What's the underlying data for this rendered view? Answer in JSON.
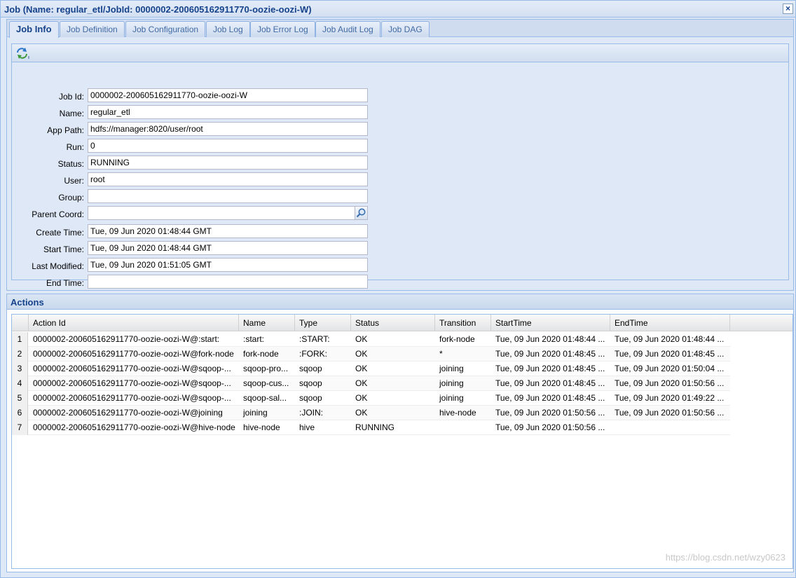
{
  "window": {
    "title": "Job (Name: regular_etl/JobId: 0000002-200605162911770-oozie-oozi-W)",
    "close_label": "×"
  },
  "tabs": [
    {
      "label": "Job Info",
      "active": true
    },
    {
      "label": "Job Definition",
      "active": false
    },
    {
      "label": "Job Configuration",
      "active": false
    },
    {
      "label": "Job Log",
      "active": false
    },
    {
      "label": "Job Error Log",
      "active": false
    },
    {
      "label": "Job Audit Log",
      "active": false
    },
    {
      "label": "Job DAG",
      "active": false
    }
  ],
  "form": {
    "refresh_icon": "refresh-icon",
    "fields": [
      {
        "label": "Job Id:",
        "value": "0000002-200605162911770-oozie-oozi-W"
      },
      {
        "label": "Name:",
        "value": "regular_etl"
      },
      {
        "label": "App Path:",
        "value": "hdfs://manager:8020/user/root"
      },
      {
        "label": "Run:",
        "value": "0"
      },
      {
        "label": "Status:",
        "value": "RUNNING"
      },
      {
        "label": "User:",
        "value": "root"
      },
      {
        "label": "Group:",
        "value": ""
      },
      {
        "label": "Parent Coord:",
        "value": "",
        "trigger_icon": "magnifier-icon"
      },
      {
        "label": "Create Time:",
        "value": "Tue, 09 Jun 2020 01:48:44 GMT"
      },
      {
        "label": "Start Time:",
        "value": "Tue, 09 Jun 2020 01:48:44 GMT"
      },
      {
        "label": "Last Modified:",
        "value": "Tue, 09 Jun 2020 01:51:05 GMT"
      },
      {
        "label": "End Time:",
        "value": ""
      }
    ]
  },
  "actions": {
    "title": "Actions",
    "columns": [
      "Action Id",
      "Name",
      "Type",
      "Status",
      "Transition",
      "StartTime",
      "EndTime"
    ],
    "rows": [
      {
        "num": "1",
        "cells": [
          "0000002-200605162911770-oozie-oozi-W@:start:",
          ":start:",
          ":START:",
          "OK",
          "fork-node",
          "Tue, 09 Jun 2020 01:48:44 ...",
          "Tue, 09 Jun 2020 01:48:44 ..."
        ]
      },
      {
        "num": "2",
        "cells": [
          "0000002-200605162911770-oozie-oozi-W@fork-node",
          "fork-node",
          ":FORK:",
          "OK",
          "*",
          "Tue, 09 Jun 2020 01:48:45 ...",
          "Tue, 09 Jun 2020 01:48:45 ..."
        ]
      },
      {
        "num": "3",
        "cells": [
          "0000002-200605162911770-oozie-oozi-W@sqoop-...",
          "sqoop-pro...",
          "sqoop",
          "OK",
          "joining",
          "Tue, 09 Jun 2020 01:48:45 ...",
          "Tue, 09 Jun 2020 01:50:04 ..."
        ]
      },
      {
        "num": "4",
        "cells": [
          "0000002-200605162911770-oozie-oozi-W@sqoop-...",
          "sqoop-cus...",
          "sqoop",
          "OK",
          "joining",
          "Tue, 09 Jun 2020 01:48:45 ...",
          "Tue, 09 Jun 2020 01:50:56 ..."
        ]
      },
      {
        "num": "5",
        "cells": [
          "0000002-200605162911770-oozie-oozi-W@sqoop-...",
          "sqoop-sal...",
          "sqoop",
          "OK",
          "joining",
          "Tue, 09 Jun 2020 01:48:45 ...",
          "Tue, 09 Jun 2020 01:49:22 ..."
        ]
      },
      {
        "num": "6",
        "cells": [
          "0000002-200605162911770-oozie-oozi-W@joining",
          "joining",
          ":JOIN:",
          "OK",
          "hive-node",
          "Tue, 09 Jun 2020 01:50:56 ...",
          "Tue, 09 Jun 2020 01:50:56 ..."
        ]
      },
      {
        "num": "7",
        "cells": [
          "0000002-200605162911770-oozie-oozi-W@hive-node",
          "hive-node",
          "hive",
          "RUNNING",
          "",
          "Tue, 09 Jun 2020 01:50:56 ...",
          ""
        ]
      }
    ]
  },
  "watermark": "https://blog.csdn.net/wzy0623"
}
